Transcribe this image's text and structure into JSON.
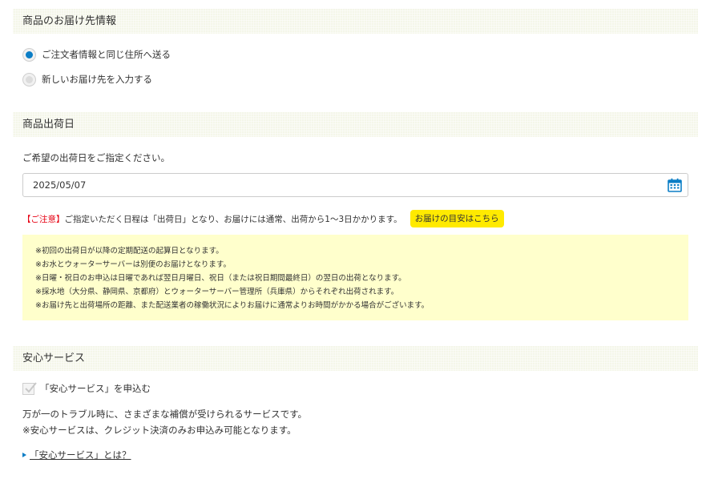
{
  "sections": {
    "shipping_info_title": "商品のお届け先情報",
    "ship_date_title": "商品出荷日",
    "safety_service_title": "安心サービス"
  },
  "shipping": {
    "options": [
      {
        "label": "ご注文者情報と同じ住所へ送る",
        "selected": true
      },
      {
        "label": "新しいお届け先を入力する",
        "selected": false
      }
    ]
  },
  "ship_date": {
    "instruction": "ご希望の出荷日をご指定ください。",
    "value": "2025/05/07",
    "caution_label": "【ご注意】",
    "caution_text": "ご指定いただく日程は「出荷日」となり、お届けには通常、出荷から1〜3日かかります。",
    "guide_button": "お届けの目安はこちら",
    "notes": [
      "※初回の出荷日が以降の定期配送の起算日となります。",
      "※お水とウォーターサーバーは別便のお届けとなります。",
      "※日曜・祝日のお申込は日曜であれば翌日月曜日、祝日（または祝日期間最終日）の翌日の出荷となります。",
      "※採水地（大分県、静岡県、京都府）とウォーターサーバー管理所（兵庫県）からそれぞれ出荷されます。",
      "※お届け先と出荷場所の距離、また配送業者の稼働状況によりお届けに通常よりお時間がかかる場合がございます。"
    ]
  },
  "safety": {
    "checkbox_label": "「安心サービス」を申込む",
    "checked": true,
    "desc1": "万が一のトラブル時に、さまざまな補償が受けられるサービスです。",
    "desc2": "※安心サービスは、クレジット決済のみお申込み可能となります。",
    "link": "「安心サービス」とは？"
  },
  "colors": {
    "accent": "#0c7ec6",
    "caution": "#e60012",
    "badge": "#ffea00",
    "note_bg": "#ffffcc",
    "header_bg": "#f4f6e9"
  }
}
